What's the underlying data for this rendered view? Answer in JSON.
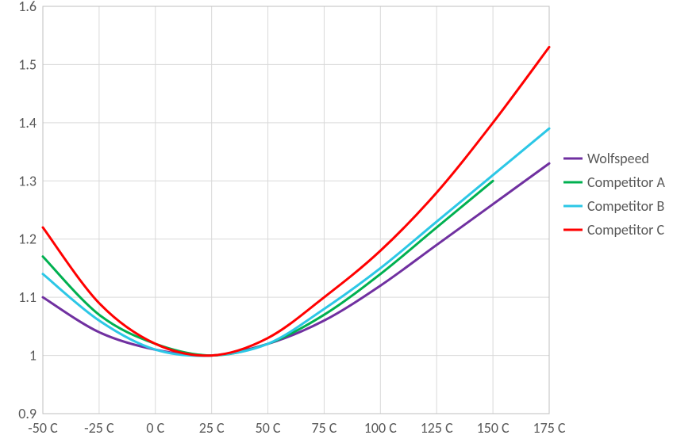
{
  "chart_data": {
    "type": "line",
    "title": "",
    "xlabel": "",
    "ylabel": "",
    "xlim": [
      -50,
      175
    ],
    "ylim": [
      0.9,
      1.6
    ],
    "x_ticks": [
      "-50 C",
      "-25 C",
      "0 C",
      "25 C",
      "50 C",
      "75 C",
      "100 C",
      "125 C",
      "150 C",
      "175 C"
    ],
    "y_ticks": [
      "0.9",
      "1",
      "1.1",
      "1.2",
      "1.3",
      "1.4",
      "1.5",
      "1.6"
    ],
    "x": [
      -50,
      -25,
      0,
      25,
      50,
      75,
      100,
      125,
      150,
      175
    ],
    "series": [
      {
        "name": "Wolfspeed",
        "color": "#7030A0",
        "values": [
          1.1,
          1.04,
          1.01,
          1.0,
          1.02,
          1.06,
          1.12,
          1.19,
          1.26,
          1.33
        ]
      },
      {
        "name": "Competitor A",
        "color": "#00B050",
        "values": [
          1.17,
          1.07,
          1.02,
          1.0,
          1.02,
          1.07,
          1.14,
          1.22,
          1.3,
          null
        ]
      },
      {
        "name": "Competitor B",
        "color": "#2CC7E6",
        "values": [
          1.14,
          1.06,
          1.01,
          1.0,
          1.02,
          1.08,
          1.15,
          1.23,
          1.31,
          1.39
        ]
      },
      {
        "name": "Competitor C",
        "color": "#FF0000",
        "values": [
          1.22,
          1.09,
          1.02,
          1.0,
          1.03,
          1.1,
          1.18,
          1.28,
          1.4,
          1.53
        ]
      }
    ],
    "legend_position": "right",
    "grid": true
  }
}
